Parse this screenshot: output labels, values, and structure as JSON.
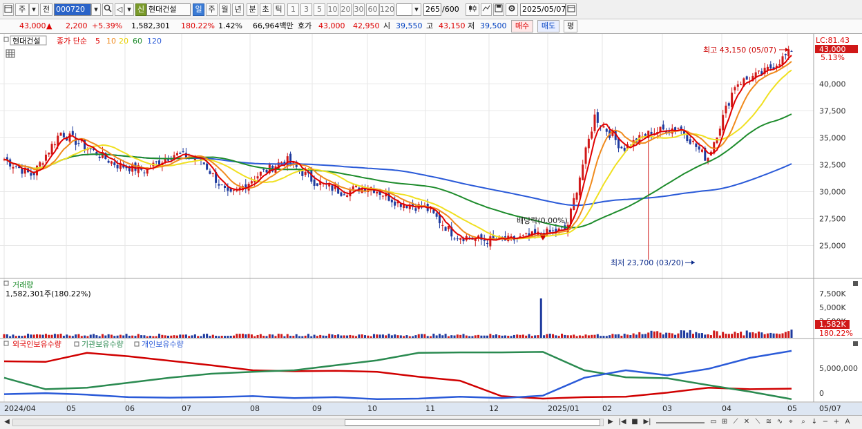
{
  "toolbar": {
    "period_label": "주",
    "prev_label": "전",
    "stock_code": "000720",
    "badge_label": "신",
    "stock_name": "현대건설",
    "period_buttons": [
      "일",
      "주",
      "월",
      "년",
      "분",
      "초",
      "틱"
    ],
    "interval_buttons": [
      "1",
      "3",
      "5",
      "10",
      "20",
      "30",
      "60",
      "120"
    ],
    "count_current": "265",
    "count_total": "/600",
    "date": "2025/05/07"
  },
  "quote": {
    "price": "43,000",
    "change": "2,200",
    "change_pct": "+5.39%",
    "volume": "1,582,301",
    "volume_ratio": "180.22%",
    "turnover": "1.42%",
    "amount": "66,964백만",
    "ask_label": "호가",
    "ask": "43,000",
    "bid": "42,950",
    "open_label": "시",
    "open": "39,550",
    "high_label": "고",
    "high": "43,150",
    "low_label": "저",
    "low": "39,500",
    "buy_label": "매수",
    "sell_label": "매도",
    "eval_label": "평"
  },
  "price_panel": {
    "legend_name": "현대건설",
    "legend_ma": "종가 단순",
    "ma_periods": [
      "5",
      "10",
      "20",
      "60",
      "120"
    ],
    "lc_label": "LC:81.43",
    "current_price_tag": "43,000",
    "current_pct_tag": "5.13%",
    "high_marker": "최고 43,150 (05/07)",
    "low_marker": "최저 23,700 (03/20)",
    "dividend_marker": "배당락(0.00%)",
    "y_ticks": [
      "40,000",
      "37,500",
      "35,000",
      "32,500",
      "30,000",
      "27,500",
      "25,000"
    ]
  },
  "volume_panel": {
    "title": "거래량",
    "value": "1,582,301주(180.22%)",
    "y_ticks": [
      "7,500K",
      "5,000K",
      "2,500K"
    ],
    "tag_value": "1,582K",
    "tag_pct": "180.22%"
  },
  "holding_panel": {
    "legend": [
      "외국인보유수량",
      "기관보유수량",
      "개인보유수량"
    ],
    "y_ticks": [
      "5,000,000",
      "0"
    ]
  },
  "x_axis": [
    "2024/04",
    "05",
    "06",
    "07",
    "08",
    "09",
    "10",
    "11",
    "12",
    "2025/01",
    "02",
    "03",
    "04",
    "05",
    "05/07"
  ],
  "colors": {
    "up": "#d01818",
    "down": "#1e3a9e",
    "ma5": "#e00000",
    "ma10": "#f08a1c",
    "ma20": "#f0e020",
    "ma60": "#1e8c2c",
    "ma120": "#2a5ad8",
    "foreign": "#d00000",
    "institution": "#2a8a50",
    "individual": "#2a5ad8"
  },
  "chart_data": {
    "type": "candlestick",
    "frequency": "daily",
    "range": [
      "2024/04",
      "2025/05/07"
    ],
    "high": {
      "value": 43150,
      "date": "05/07"
    },
    "low": {
      "value": 23700,
      "date": "03/20"
    },
    "last_close": 43000,
    "close_approx": [
      33000,
      31500,
      35500,
      34000,
      32500,
      32000,
      33500,
      33000,
      29500,
      31500,
      33000,
      31000,
      30000,
      30500,
      29000,
      28500,
      26000,
      25500,
      25500,
      26000,
      26500,
      37000,
      34000,
      35500,
      36000,
      33000,
      40000,
      41000,
      43000
    ],
    "close_dates_approx": [
      "2024/04",
      "2024/04",
      "2024/05",
      "2024/05",
      "2024/06",
      "2024/07",
      "2024/07",
      "2024/08",
      "2024/08",
      "2024/09",
      "2024/09",
      "2024/10",
      "2024/10",
      "2024/11",
      "2024/11",
      "2024/12",
      "2024/12",
      "2024/12",
      "2025/01",
      "2025/01",
      "2025/02",
      "2025/02",
      "2025/03",
      "2025/03",
      "2025/03",
      "2025/04",
      "2025/04",
      "2025/05",
      "2025/05/07"
    ]
  }
}
